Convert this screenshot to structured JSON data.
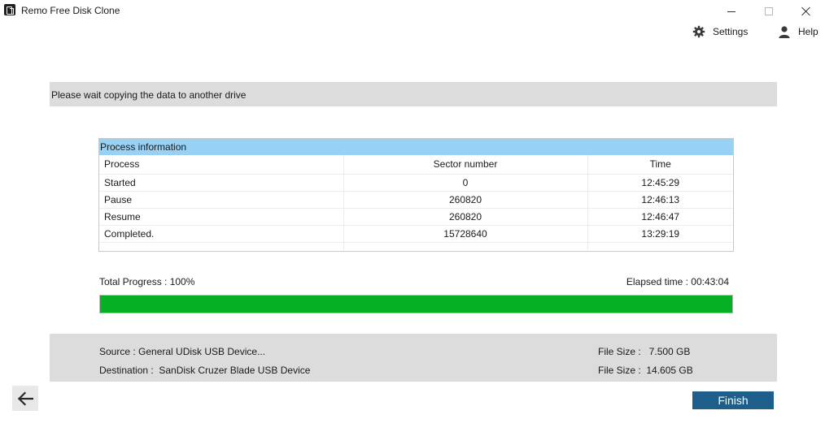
{
  "window": {
    "title": "Remo Free Disk Clone",
    "app_icon": "remo-logo-icon",
    "controls": [
      "minimize-icon",
      "maximize-icon",
      "close-icon"
    ]
  },
  "toolbar": {
    "settings": {
      "label": "Settings",
      "icon": "gear-icon"
    },
    "help": {
      "label": "Help",
      "icon": "user-icon"
    }
  },
  "status_message": "Please wait copying the data to another drive",
  "process_info": {
    "title": "Process information",
    "columns": [
      "Process",
      "Sector number",
      "Time"
    ],
    "rows": [
      {
        "process": "Started",
        "sector": "0",
        "time": "12:45:29"
      },
      {
        "process": "Pause",
        "sector": "260820",
        "time": "12:46:13"
      },
      {
        "process": "Resume",
        "sector": "260820",
        "time": "12:46:47"
      },
      {
        "process": "Completed.",
        "sector": "15728640",
        "time": "13:29:19"
      }
    ]
  },
  "progress": {
    "label": "Total Progress :  100%",
    "percent": 100,
    "elapsed": "Elapsed time :   00:43:04",
    "fill_color": "#06b025"
  },
  "drive_info": {
    "source": "Source : General UDisk USB Device...",
    "destination": "Destination :  SanDisk Cruzer Blade USB Device",
    "source_size": "File Size :   7.500 GB",
    "destination_size": "File Size :  14.605 GB"
  },
  "buttons": {
    "back_icon": "arrow-left-icon",
    "finish": "Finish"
  },
  "colors": {
    "panel_header": "#99d1f4",
    "banner": "#dcdcdc",
    "finish_button": "#1d5f8a",
    "progress": "#06b025"
  }
}
